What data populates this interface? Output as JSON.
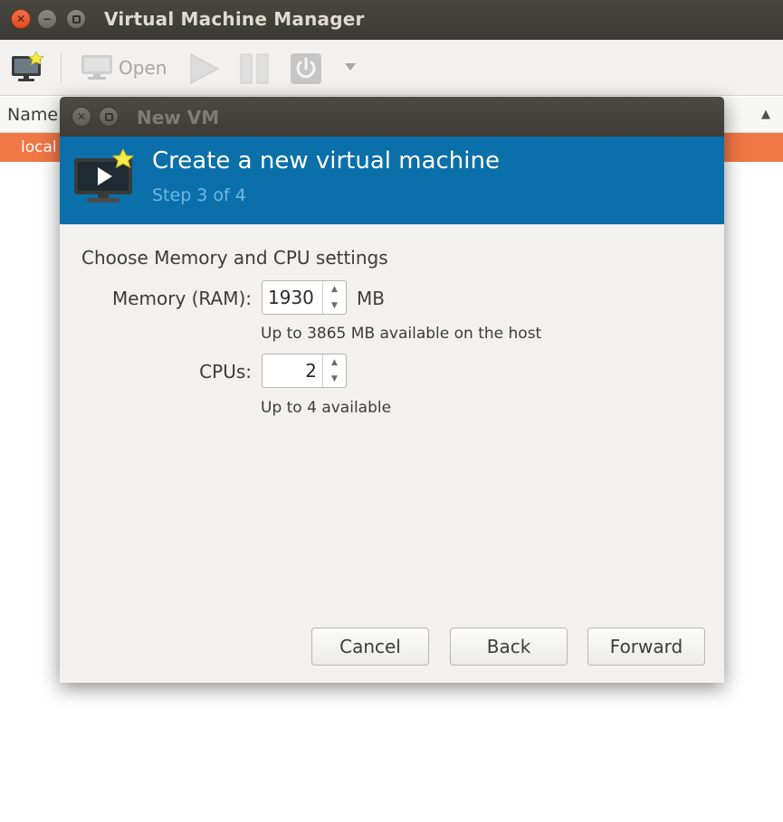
{
  "main_window": {
    "title": "Virtual Machine Manager",
    "toolbar": {
      "open_label": "Open"
    },
    "list": {
      "column_name": "Name",
      "row_label": "local"
    }
  },
  "dialog": {
    "title": "New VM",
    "header": {
      "title": "Create a new virtual machine",
      "step": "Step 3 of 4"
    },
    "section_title": "Choose Memory and CPU settings",
    "memory": {
      "label": "Memory (RAM):",
      "value": "1930",
      "unit": "MB",
      "hint": "Up to 3865 MB available on the host"
    },
    "cpus": {
      "label": "CPUs:",
      "value": "2",
      "hint": "Up to 4 available"
    },
    "buttons": {
      "cancel": "Cancel",
      "back": "Back",
      "forward": "Forward"
    }
  },
  "colors": {
    "header_blue": "#0b70a9",
    "selection_orange": "#f07746",
    "close_button": "#df4a1e"
  },
  "icons": {
    "window_close": "close-icon",
    "window_minimize": "minimize-icon",
    "window_maximize": "maximize-icon",
    "new_vm": "new-vm-icon",
    "open": "monitor-icon",
    "run": "play-icon",
    "pause": "pause-icon",
    "shutdown": "power-icon",
    "dropdown": "chevron-down-icon"
  }
}
